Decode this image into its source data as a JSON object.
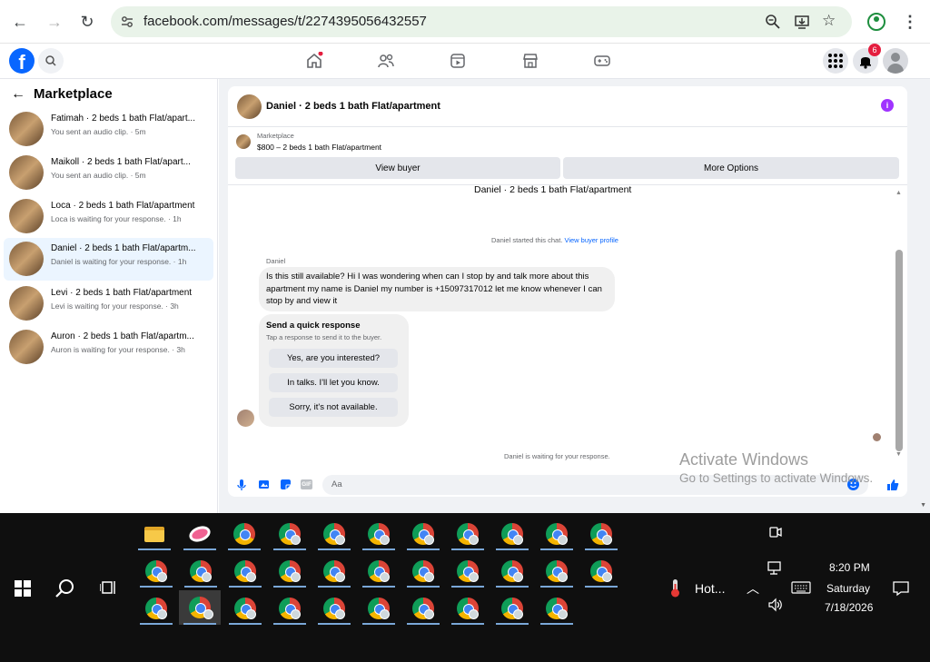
{
  "browser": {
    "url": "facebook.com/messages/t/2274395056432557"
  },
  "fb": {
    "notification_count": "6"
  },
  "sidebar": {
    "title": "Marketplace",
    "conversations": [
      {
        "title": "Fatimah · 2 beds 1 bath Flat/apart...",
        "subtitle": "You sent an audio clip. · 5m"
      },
      {
        "title": "Maikoll · 2 beds 1 bath Flat/apart...",
        "subtitle": "You sent an audio clip. · 5m"
      },
      {
        "title": "Loca · 2 beds 1 bath Flat/apartment",
        "subtitle": "Loca is waiting for your response. · 1h"
      },
      {
        "title": "Daniel · 2 beds 1 bath Flat/apartm...",
        "subtitle": "Daniel is waiting for your response. · 1h"
      },
      {
        "title": "Levi · 2 beds 1 bath Flat/apartment",
        "subtitle": "Levi is waiting for your response. · 3h"
      },
      {
        "title": "Auron · 2 beds 1 bath Flat/apartm...",
        "subtitle": "Auron is waiting for your response. · 3h"
      }
    ]
  },
  "chat": {
    "header_title": "Daniel · 2 beds 1 bath Flat/apartment",
    "listing_source": "Marketplace",
    "listing_price": "$800 – 2 beds 1 bath Flat/apartment",
    "view_buyer": "View buyer",
    "more_options": "More Options",
    "thread_title": "Daniel · 2 beds 1 bath Flat/apartment",
    "started_text": "Daniel started this chat.",
    "view_profile": "View buyer profile",
    "sender": "Daniel",
    "message": "Is this still available? Hi I was wondering when can I stop by and talk more about this apartment my name is Daniel my number is +15097317012 let me know whenever I can stop by and view it",
    "quick_title": "Send a quick response",
    "quick_subtitle": "Tap a response to send it to the buyer.",
    "quick_responses": [
      "Yes, are you interested?",
      "In talks. I'll let you know.",
      "Sorry, it's not available."
    ],
    "waiting_text": "Daniel is waiting for your response.",
    "composer_placeholder": "Aa"
  },
  "watermark": {
    "line1": "Activate Windows",
    "line2": "Go to Settings to activate Windows."
  },
  "taskbar": {
    "weather": "Hot...",
    "time": "8:20 PM",
    "day": "Saturday",
    "date": "7/18/2026"
  }
}
